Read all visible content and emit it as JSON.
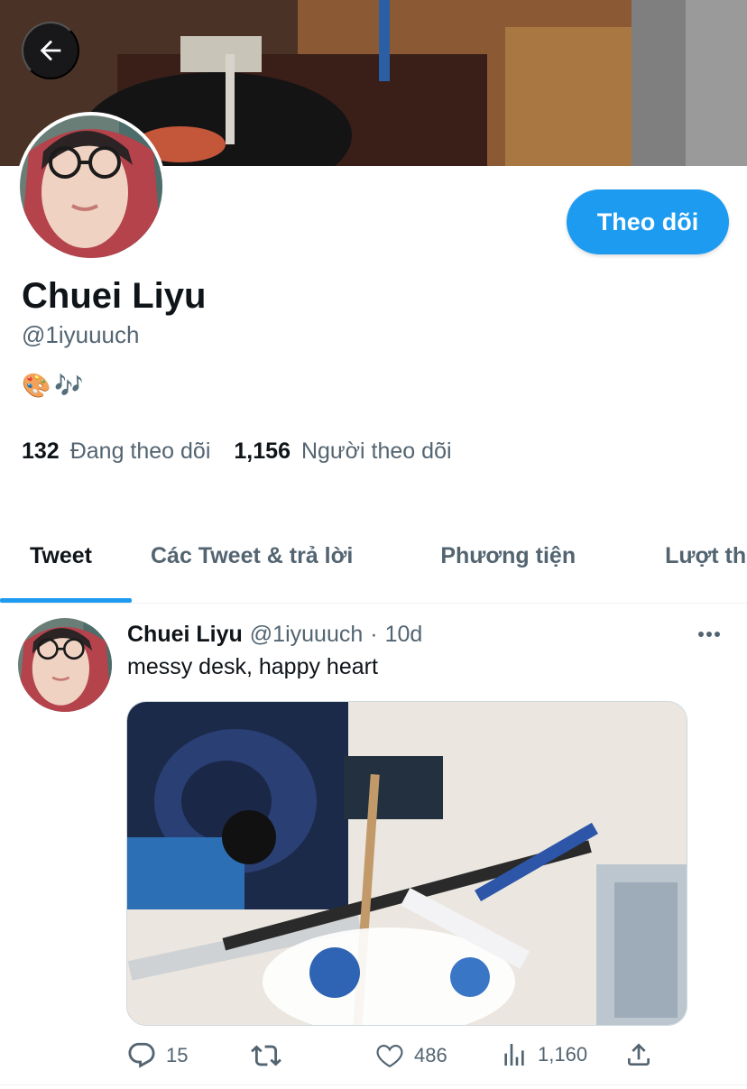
{
  "profile": {
    "name": "Chuei Liyu",
    "handle": "@1iyuuuch",
    "bio_emoji_1": "🎨",
    "bio_emoji_2": "🎶",
    "following_count": "132",
    "following_label": "Đang theo dõi",
    "followers_count": "1,156",
    "followers_label": "Người theo dõi",
    "follow_button_label": "Theo dõi"
  },
  "tabs": [
    {
      "label": "Tweet",
      "active": true
    },
    {
      "label": "Các Tweet & trả lời",
      "active": false
    },
    {
      "label": "Phương tiện",
      "active": false
    },
    {
      "label": "Lượt thích",
      "active": false
    }
  ],
  "tweet": {
    "author_name": "Chuei Liyu",
    "author_handle": "@1iyuuuch",
    "separator": "·",
    "age": "10d",
    "text": "messy desk, happy heart",
    "replies": "15",
    "retweets": "",
    "likes": "486",
    "views": "1,160"
  },
  "colors": {
    "accent": "#1d9bf0",
    "text_primary": "#0f1419",
    "text_secondary": "#536471"
  },
  "icons": {
    "back": "arrow-left-icon",
    "more": "more-horizontal-icon",
    "reply": "reply-icon",
    "retweet": "retweet-icon",
    "like": "heart-icon",
    "views": "views-chart-icon",
    "share": "share-icon"
  }
}
